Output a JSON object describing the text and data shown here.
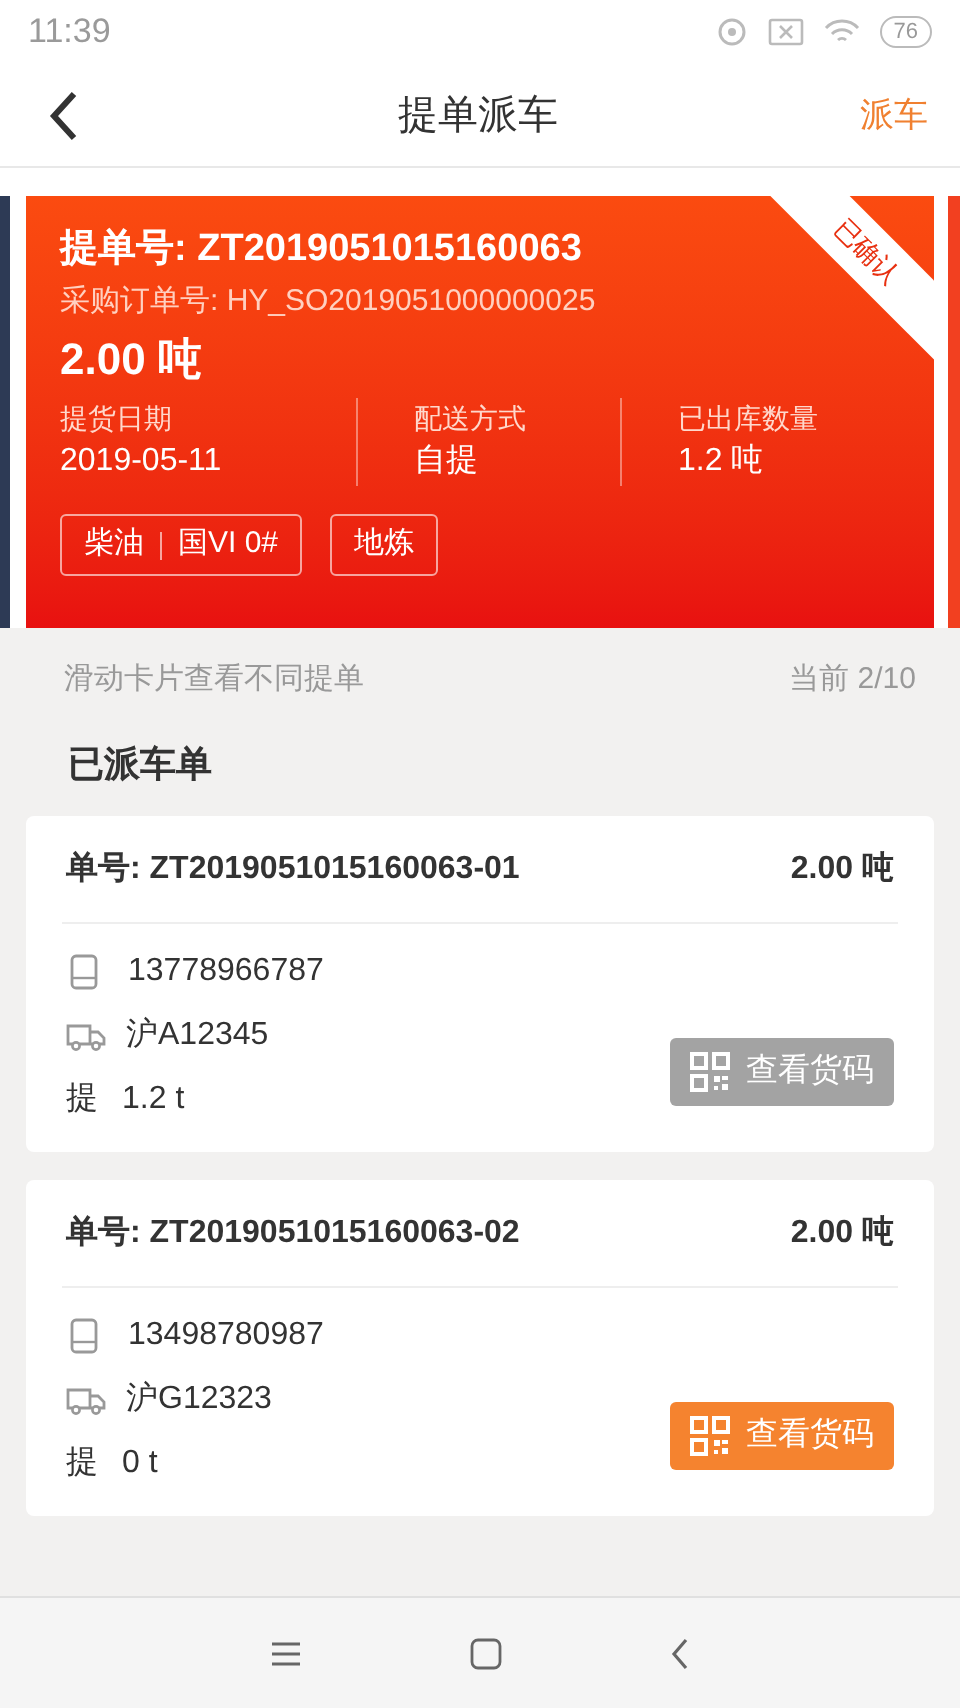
{
  "status_bar": {
    "time": "11:39",
    "battery": "76"
  },
  "header": {
    "title": "提单派车",
    "action": "派车"
  },
  "bill_card": {
    "title": "提单号: ZT2019051015160063",
    "purchase_order": "采购订单号: HY_SO2019051000000025",
    "quantity": "2.00 吨",
    "badge": "已确认",
    "stats": [
      {
        "label": "提货日期",
        "value": "2019-05-11"
      },
      {
        "label": "配送方式",
        "value": "自提"
      },
      {
        "label": "已出库数量",
        "value": "1.2 吨"
      }
    ],
    "tags": [
      {
        "parts": [
          "柴油",
          "国VI 0#"
        ]
      },
      {
        "parts": [
          "地炼"
        ]
      }
    ]
  },
  "carousel_hint": {
    "text": "滑动卡片查看不同提单",
    "position": "当前 2/10"
  },
  "section_title": "已派车单",
  "dispatch_orders": [
    {
      "number": "单号: ZT2019051015160063-01",
      "quantity": "2.00 吨",
      "phone": "13778966787",
      "plate": "沪A12345",
      "pickup_label": "提",
      "pickup": "1.2 t",
      "button": "查看货码",
      "disabled": true
    },
    {
      "number": "单号: ZT2019051015160063-02",
      "quantity": "2.00 吨",
      "phone": "13498780987",
      "plate": "沪G12323",
      "pickup_label": "提",
      "pickup": "0 t",
      "button": "查看货码",
      "disabled": false
    }
  ]
}
